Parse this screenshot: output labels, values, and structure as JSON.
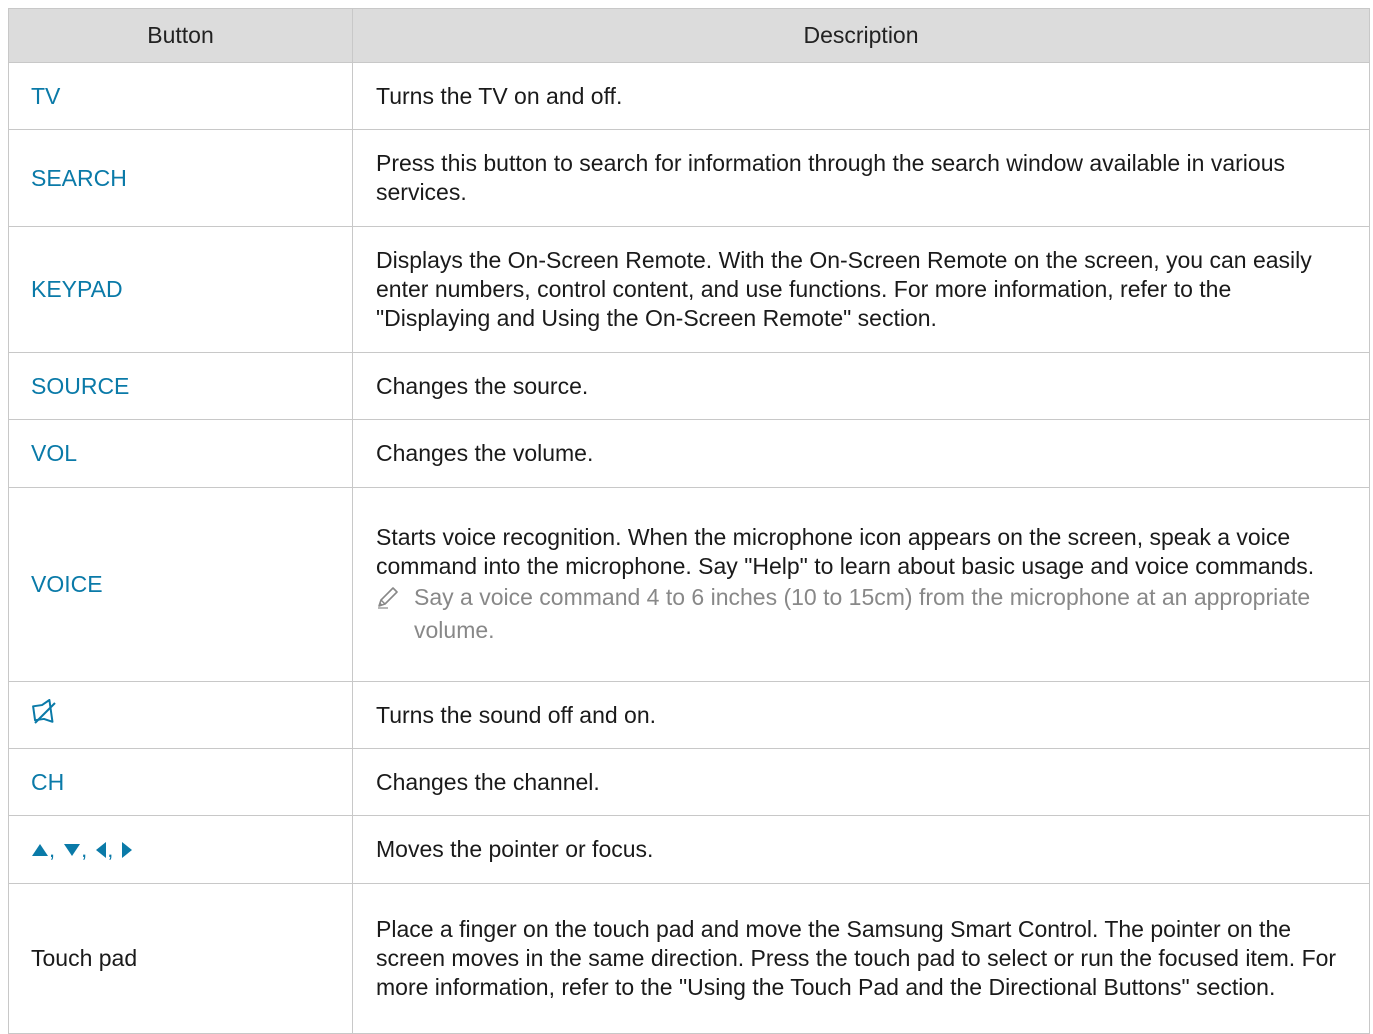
{
  "table": {
    "headers": [
      "Button",
      "Description"
    ],
    "rows": [
      {
        "button": "TV",
        "description": "Turns the TV on and off."
      },
      {
        "button": "SEARCH",
        "description": "Press this button to search for information through the search window available in various services."
      },
      {
        "button": "KEYPAD",
        "description": "Displays the On-Screen Remote. With the On-Screen Remote on the screen, you can easily enter numbers, control content, and use functions. For more information, refer to the \"Displaying and Using the On-Screen Remote\" section."
      },
      {
        "button": "SOURCE",
        "description": "Changes the source."
      },
      {
        "button": "VOL",
        "description": "Changes the volume."
      },
      {
        "button": "VOICE",
        "description": "Starts voice recognition. When the microphone icon appears on the screen, speak a voice command into the microphone. Say \"Help\" to learn about basic usage and voice commands.",
        "note": "Say a voice command 4 to 6 inches (10 to 15cm) from the microphone at an appropriate volume."
      },
      {
        "button_icon": "mute-icon",
        "description": "Turns the sound off and on."
      },
      {
        "button": "CH",
        "description": "Changes the channel."
      },
      {
        "button_icons": [
          "up-arrow-icon",
          "down-arrow-icon",
          "left-arrow-icon",
          "right-arrow-icon"
        ],
        "button_separator": ",",
        "description": "Moves the pointer or focus."
      },
      {
        "button": "Touch pad",
        "description": "Place a finger on the touch pad and move the Samsung Smart Control. The pointer on the screen moves in the same direction. Press the touch pad to select or run the focused item. For more information, refer to the \"Using the Touch Pad and the Directional Buttons\" section."
      }
    ]
  },
  "colors": {
    "button_name": "#0a7aa8",
    "header_bg": "#dcdcdc",
    "border": "#c8c8c8",
    "note_text": "#888888"
  }
}
